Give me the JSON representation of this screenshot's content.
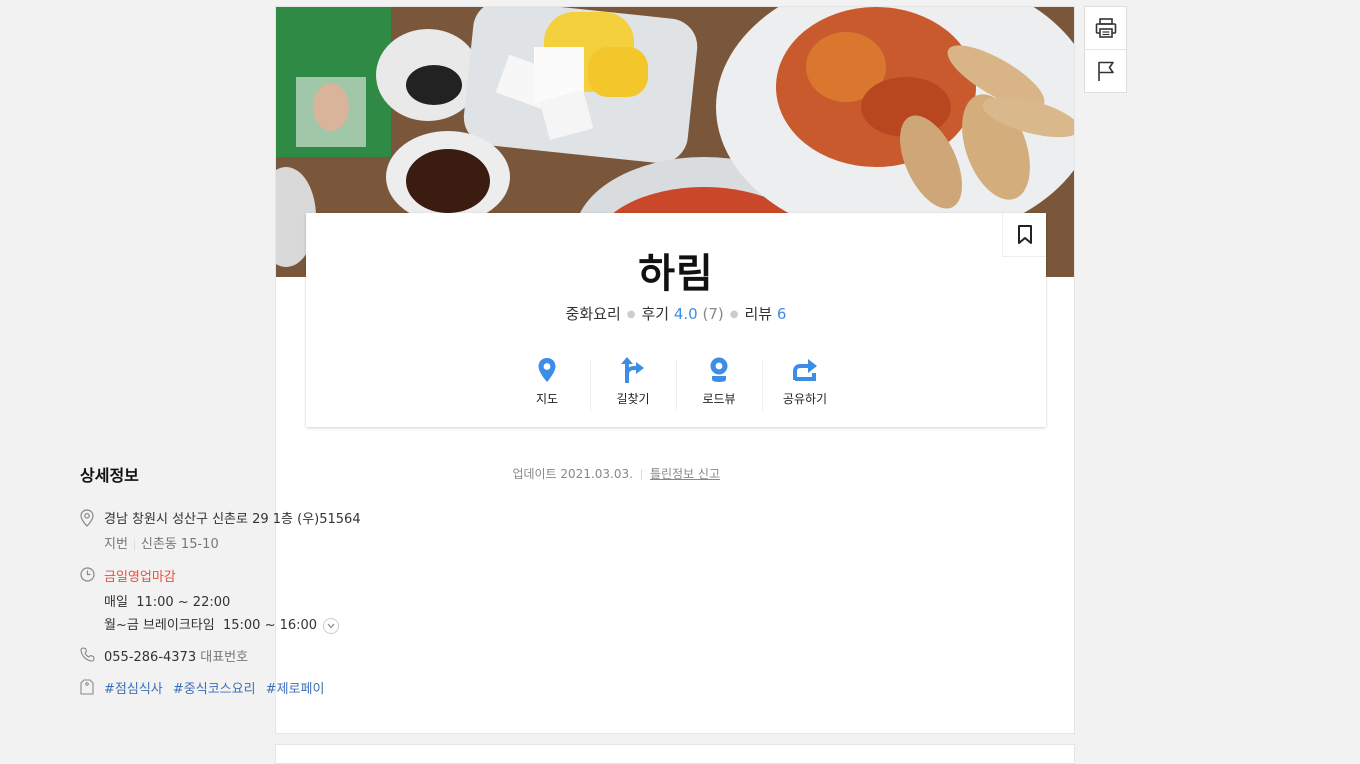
{
  "place": {
    "name": "하림",
    "category": "중화요리",
    "review_label": "후기",
    "rating": "4.0",
    "review_count": "(7)",
    "blog_label": "리뷰",
    "blog_count": "6"
  },
  "actions": [
    {
      "label": "지도",
      "icon": "map-pin-icon"
    },
    {
      "label": "길찾기",
      "icon": "directions-icon"
    },
    {
      "label": "로드뷰",
      "icon": "roadview-icon"
    },
    {
      "label": "공유하기",
      "icon": "share-icon"
    }
  ],
  "detail": {
    "title": "상세정보",
    "updated": "업데이트 2021.03.03.",
    "report": "틀린정보 신고",
    "address": "경남 창원시 성산구 신촌로 29 1층 (우)51564",
    "jibun_label": "지번",
    "jibun": "신촌동 15-10",
    "status": "금일영업마감",
    "hours": [
      {
        "day": "매일",
        "time": "11:00 ~ 22:00"
      },
      {
        "day": "월~금 브레이크타임",
        "time": "15:00 ~ 16:00"
      }
    ],
    "phone": "055-286-4373",
    "phone_label": "대표번호",
    "tags": [
      "#점심식사",
      "#중식코스요리",
      "#제로페이"
    ]
  },
  "colors": {
    "accent": "#3d8ce6",
    "closed": "#e8503f",
    "tag": "#3d6fb8"
  }
}
